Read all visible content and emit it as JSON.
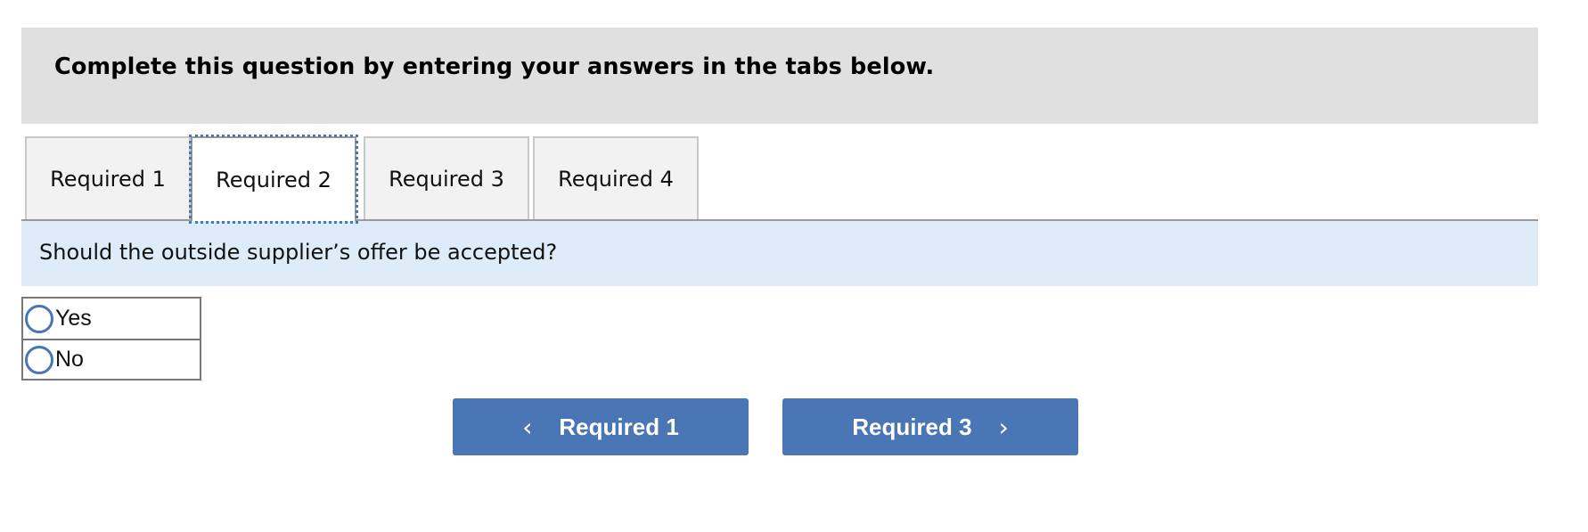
{
  "instructions": {
    "text": "Complete this question by entering your answers in the tabs below."
  },
  "tabs": [
    {
      "label": "Required 1",
      "active": false
    },
    {
      "label": "Required 2",
      "active": true
    },
    {
      "label": "Required 3",
      "active": false
    },
    {
      "label": "Required 4",
      "active": false
    }
  ],
  "question": {
    "text": "Should the outside supplier’s offer be accepted?"
  },
  "choices": [
    {
      "label": "Yes",
      "selected": false,
      "icon": "radio-unchecked-icon"
    },
    {
      "label": "No",
      "selected": false,
      "icon": "radio-unchecked-icon"
    }
  ],
  "navigation": {
    "prev": {
      "label": "Required 1",
      "icon": "chevron-left-icon",
      "glyph": "‹"
    },
    "next": {
      "label": "Required 3",
      "icon": "chevron-right-icon",
      "glyph": "›"
    }
  },
  "colors": {
    "accent": "#4a76b5",
    "instructions_bg": "#e0e0e0",
    "question_bg": "#deebf8",
    "tab_bg": "#f2f2f2"
  }
}
